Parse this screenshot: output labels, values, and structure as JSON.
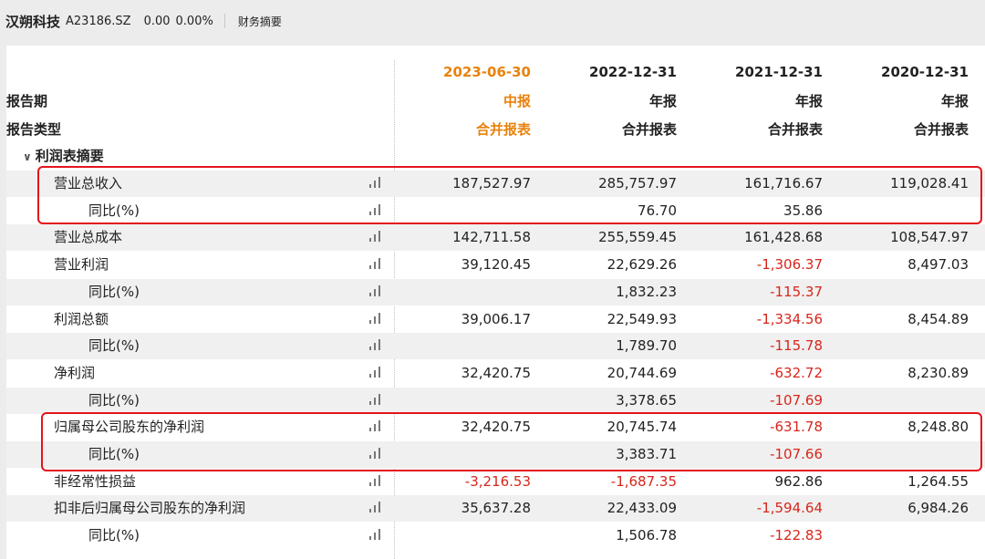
{
  "stock": {
    "name": "汉朔科技",
    "code": "A23186.SZ",
    "price": "0.00",
    "change_pct": "0.00%",
    "section": "财务摘要"
  },
  "header": {
    "dates": [
      "2023-06-30",
      "2022-12-31",
      "2021-12-31",
      "2020-12-31"
    ],
    "period_label": "报告期",
    "periods": [
      "中报",
      "年报",
      "年报",
      "年报"
    ],
    "type_label": "报告类型",
    "types": [
      "合并报表",
      "合并报表",
      "合并报表",
      "合并报表"
    ]
  },
  "section_title": "利润表摘要",
  "rows": [
    {
      "label": "营业总收入",
      "values": [
        "187,527.97",
        "285,757.97",
        "161,716.67",
        "119,028.41"
      ]
    },
    {
      "label": "同比(%)",
      "values": [
        "",
        "76.70",
        "35.86",
        ""
      ]
    },
    {
      "label": "营业总成本",
      "values": [
        "142,711.58",
        "255,559.45",
        "161,428.68",
        "108,547.97"
      ]
    },
    {
      "label": "营业利润",
      "values": [
        "39,120.45",
        "22,629.26",
        "-1,306.37",
        "8,497.03"
      ]
    },
    {
      "label": "同比(%)",
      "values": [
        "",
        "1,832.23",
        "-115.37",
        ""
      ]
    },
    {
      "label": "利润总额",
      "values": [
        "39,006.17",
        "22,549.93",
        "-1,334.56",
        "8,454.89"
      ]
    },
    {
      "label": "同比(%)",
      "values": [
        "",
        "1,789.70",
        "-115.78",
        ""
      ]
    },
    {
      "label": "净利润",
      "values": [
        "32,420.75",
        "20,744.69",
        "-632.72",
        "8,230.89"
      ]
    },
    {
      "label": "同比(%)",
      "values": [
        "",
        "3,378.65",
        "-107.69",
        ""
      ]
    },
    {
      "label": "归属母公司股东的净利润",
      "values": [
        "32,420.75",
        "20,745.74",
        "-631.78",
        "8,248.80"
      ]
    },
    {
      "label": "同比(%)",
      "values": [
        "",
        "3,383.71",
        "-107.66",
        ""
      ]
    },
    {
      "label": "非经常性损益",
      "values": [
        "-3,216.53",
        "-1,687.35",
        "962.86",
        "1,264.55"
      ]
    },
    {
      "label": "扣非后归属母公司股东的净利润",
      "values": [
        "35,637.28",
        "22,433.09",
        "-1,594.64",
        "6,984.26"
      ]
    },
    {
      "label": "同比(%)",
      "values": [
        "",
        "1,506.78",
        "-122.83",
        ""
      ]
    }
  ],
  "colors": {
    "negative": "#d7261c",
    "latest_period": "#e8820c",
    "highlight_box": "#e3141b"
  },
  "icons": {
    "chart": "bar-chart-icon",
    "collapse": "chevron-down-icon"
  }
}
